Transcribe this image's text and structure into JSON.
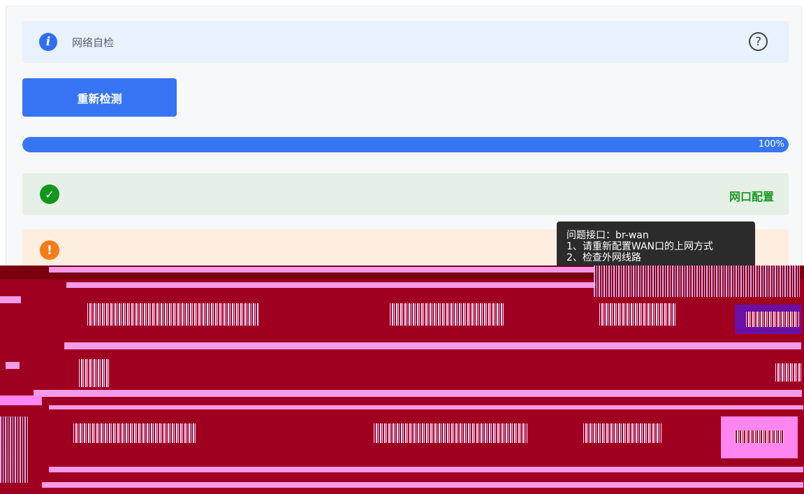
{
  "header": {
    "title": "网络自检",
    "info_icon": "i",
    "help_icon": "?"
  },
  "actions": {
    "retest_label": "重新检测"
  },
  "progress": {
    "value": 100,
    "label": "100%"
  },
  "checks": [
    {
      "status": "ok",
      "icon": "✓",
      "label": "网口配置",
      "color": "#189a22"
    },
    {
      "status": "warning",
      "icon": "!",
      "label": "",
      "color": "#f57c16"
    }
  ],
  "tooltip": {
    "lines": [
      "问题接口：br-wan",
      "1、请重新配置WAN口的上网方式",
      "2、检查外网线路"
    ]
  },
  "colors": {
    "accent": "#3775f5",
    "ok": "#13961c",
    "warning": "#f57c16"
  }
}
